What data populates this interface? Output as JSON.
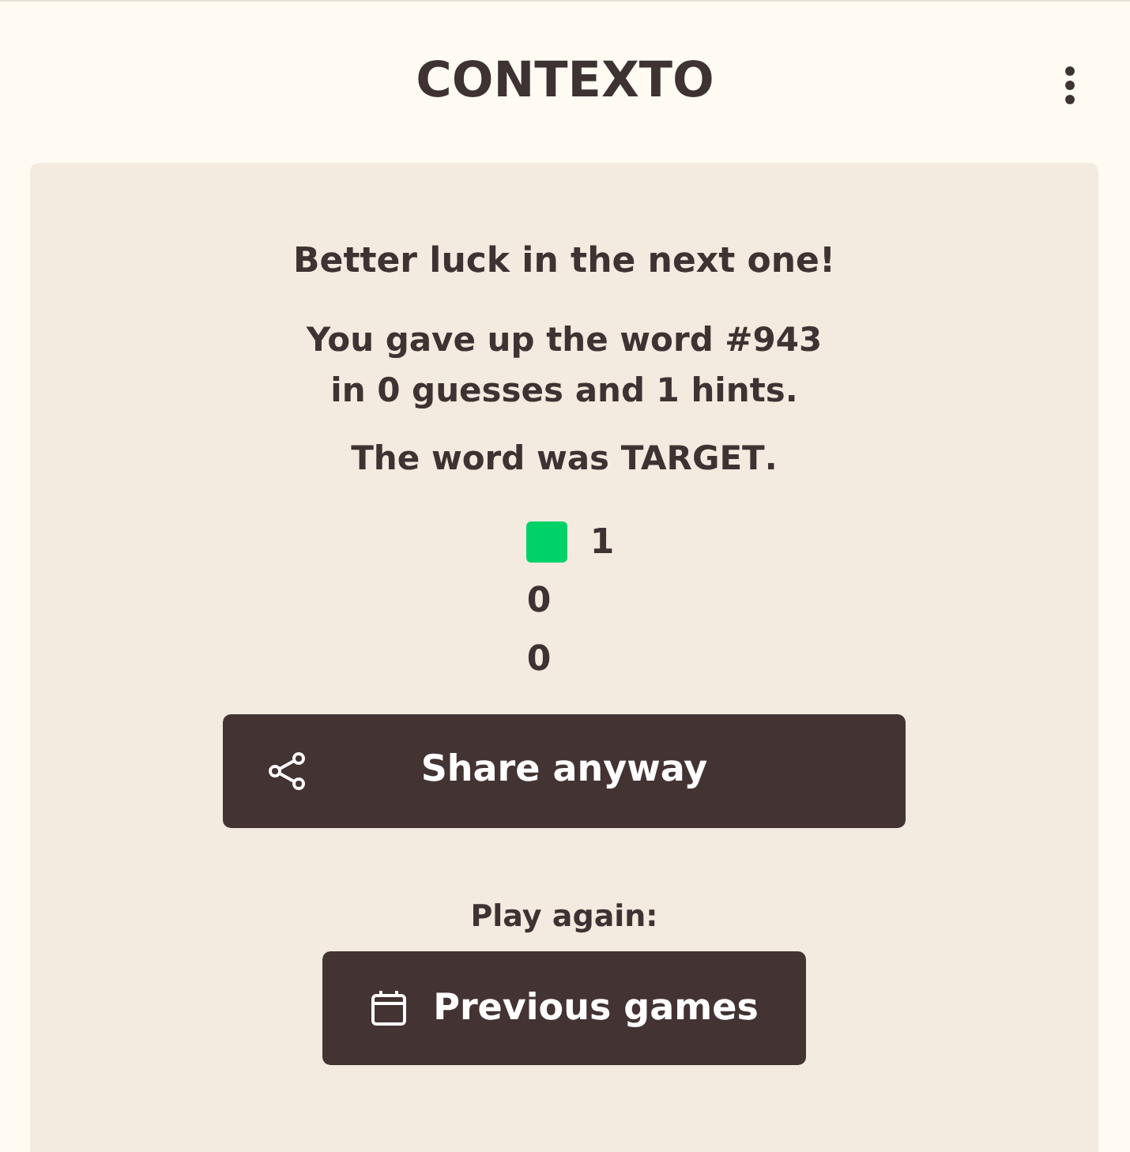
{
  "header": {
    "title": "CONTEXTO"
  },
  "result": {
    "heading": "Better luck in the next one!",
    "paragraphs": [
      "You gave up the word **#943**\nin **0** guesses and **1** hints.",
      "The word was **TARGET**."
    ],
    "stats": [
      {
        "color": "#00d26a",
        "count": "1"
      },
      {
        "count": "0"
      },
      {
        "count": "0"
      }
    ],
    "share_button": "Share anyway",
    "play_again_label": "Play again:",
    "previous_games_button": "Previous games"
  }
}
